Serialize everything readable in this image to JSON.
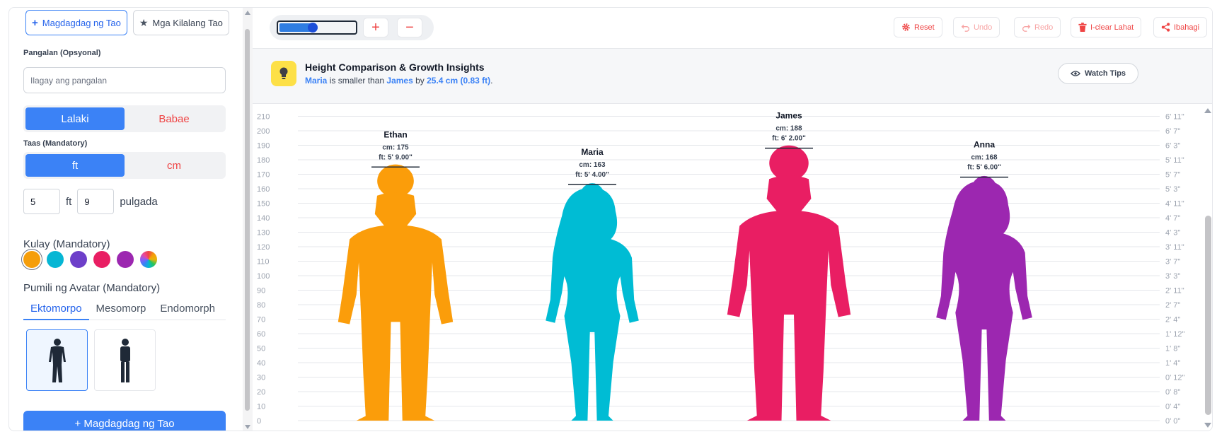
{
  "sidebar": {
    "add_person_label": "Magdagdag ng Tao",
    "famous_label": "Mga Kilalang Tao",
    "name_label": "Pangalan (Opsyonal)",
    "name_placeholder": "Ilagay ang pangalan",
    "gender": {
      "male": "Lalaki",
      "female": "Babae",
      "selected": "male"
    },
    "height_label": "Taas (Mandatory)",
    "unit": {
      "ft": "ft",
      "cm": "cm",
      "selected": "ft"
    },
    "height_ft_value": "5",
    "ft_unit": "ft",
    "height_in_value": "9",
    "in_unit": "pulgada",
    "color_label": "Kulay (Mandatory)",
    "colors": [
      "#f59e0b",
      "#06b6d4",
      "#6d3fc9",
      "#e91e63",
      "#9c27b0"
    ],
    "selected_color": "#f59e0b",
    "avatar_label": "Pumili ng Avatar (Mandatory)",
    "tabs": [
      "Ektomorpo",
      "Mesomorp",
      "Endomorph"
    ],
    "selected_tab": "Ektomorpo",
    "add_button": "+ Magdagdag ng Tao"
  },
  "toolbar": {
    "zoom_percent": 45,
    "reset": "Reset",
    "undo": "Undo",
    "redo": "Redo",
    "clear_all": "I-clear Lahat",
    "share": "Ibahagi"
  },
  "insight": {
    "title": "Height Comparison & Growth Insights",
    "person_a": "Maria",
    "middle": " is smaller than ",
    "person_b": "James",
    "by": " by ",
    "diff": "25.4 cm (0.83 ft)",
    "end": ".",
    "watch_tips": "Watch Tips"
  },
  "chart_data": {
    "type": "height-comparison",
    "y_cm_ticks": [
      0,
      10,
      20,
      30,
      40,
      50,
      60,
      70,
      80,
      90,
      100,
      110,
      120,
      130,
      140,
      150,
      160,
      170,
      180,
      190,
      200,
      210
    ],
    "y_ft_ticks": [
      "0' 0\"",
      "0' 4\"",
      "0' 8\"",
      "0' 12\"",
      "1' 4\"",
      "1' 8\"",
      "1' 12\"",
      "2' 4\"",
      "2' 7\"",
      "2' 11\"",
      "3' 3\"",
      "3' 7\"",
      "3' 11\"",
      "4' 3\"",
      "4' 7\"",
      "4' 11\"",
      "5' 3\"",
      "5' 7\"",
      "5' 11\"",
      "6' 3\"",
      "6' 7\"",
      "6' 11\""
    ],
    "y_range_cm": [
      0,
      210
    ],
    "people": [
      {
        "name": "Ethan",
        "cm": 175,
        "cm_label": "cm: 175",
        "ft_label": "ft: 5' 9.00\"",
        "color": "#fb9d0a",
        "gender": "male"
      },
      {
        "name": "Maria",
        "cm": 163,
        "cm_label": "cm: 163",
        "ft_label": "ft: 5' 4.00\"",
        "color": "#00bcd4",
        "gender": "female"
      },
      {
        "name": "James",
        "cm": 188,
        "cm_label": "cm: 188",
        "ft_label": "ft: 6' 2.00\"",
        "color": "#e91e63",
        "gender": "male"
      },
      {
        "name": "Anna",
        "cm": 168,
        "cm_label": "cm: 168",
        "ft_label": "ft: 5' 6.00\"",
        "color": "#9c27b0",
        "gender": "female"
      }
    ]
  }
}
